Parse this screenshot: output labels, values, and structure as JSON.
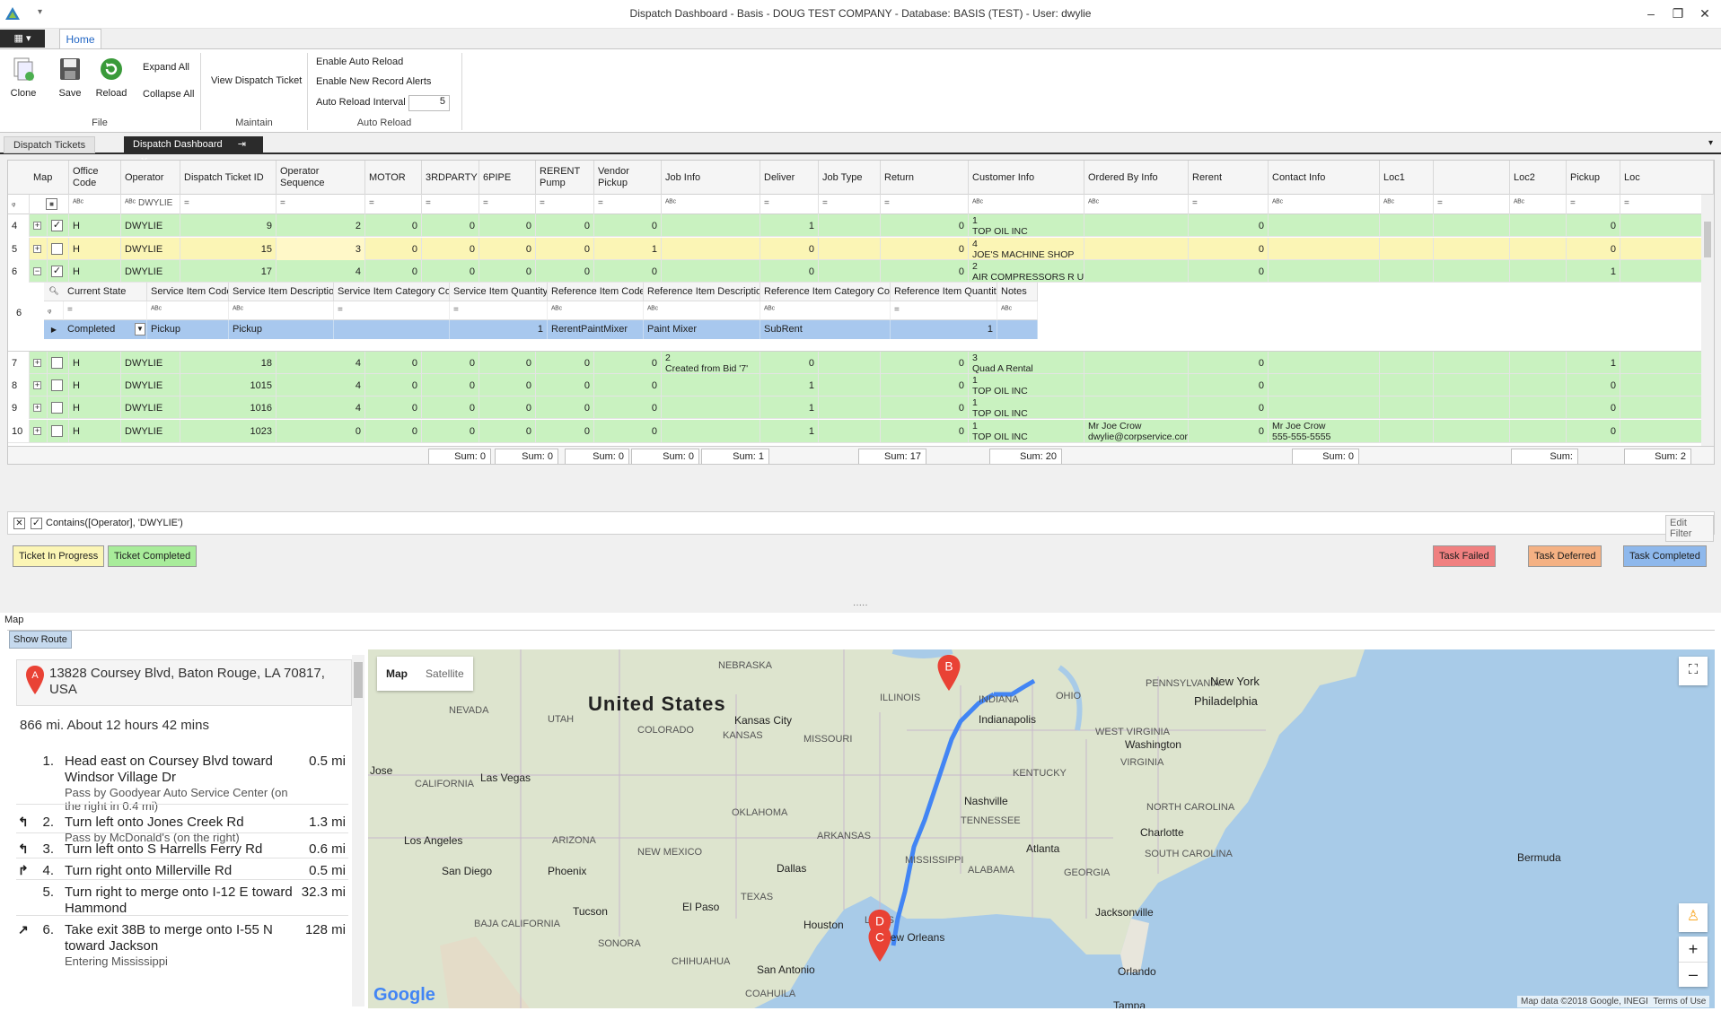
{
  "window": {
    "title": "Dispatch Dashboard - Basis - DOUG TEST COMPANY - Database: BASIS (TEST) - User: dwylie"
  },
  "ribbon": {
    "tab": "Home",
    "clone": "Clone",
    "save": "Save",
    "reload": "Reload",
    "expand_all": "Expand All",
    "collapse_all": "Collapse All",
    "file_group": "File",
    "view_ticket": "View Dispatch Ticket",
    "maintain_group": "Maintain",
    "enable_auto_reload": "Enable Auto Reload",
    "enable_alerts": "Enable New Record Alerts",
    "interval_label": "Auto Reload Interval",
    "interval_value": "5",
    "auto_reload_group": "Auto Reload"
  },
  "doc_tabs": {
    "tab1": "Dispatch Tickets",
    "tab2": "Dispatch Dashboard"
  },
  "grid": {
    "headers": [
      "Map",
      "Office Code",
      "Operator",
      "Dispatch Ticket ID",
      "Operator Sequence",
      "MOTOR",
      "3RDPARTY",
      "6PIPE",
      "RERENT Pump",
      "Vendor Pickup",
      "Job Info",
      "Deliver",
      "Job Type",
      "Return",
      "Customer Info",
      "Ordered By Info",
      "Rerent",
      "Contact Info",
      "Loc1",
      "",
      "Loc2",
      "Pickup",
      "Loc"
    ],
    "filter_operator": "DWYLIE",
    "rows": [
      {
        "rn": "4",
        "office": "H",
        "op": "DWYLIE",
        "id": "9",
        "seq": "2",
        "motor": "0",
        "third": "0",
        "pipe": "0",
        "rerent": "0",
        "vendor": "0",
        "job1": "",
        "job2": "",
        "deliver": "1",
        "jobtype": "",
        "ret": "0",
        "cust1": "1",
        "cust2": "TOP OIL INC",
        "ord1": "",
        "ord2": "",
        "rerent2": "0",
        "contact1": "",
        "contact2": "",
        "pickup": "0"
      },
      {
        "rn": "5",
        "office": "H",
        "op": "DWYLIE",
        "id": "15",
        "seq": "3",
        "motor": "0",
        "third": "0",
        "pipe": "0",
        "rerent": "0",
        "vendor": "1",
        "job1": "",
        "job2": "",
        "deliver": "0",
        "jobtype": "",
        "ret": "0",
        "cust1": "4",
        "cust2": "JOE'S MACHINE SHOP",
        "ord1": "",
        "ord2": "",
        "rerent2": "0",
        "contact1": "",
        "contact2": "",
        "pickup": "0"
      },
      {
        "rn": "6",
        "office": "H",
        "op": "DWYLIE",
        "id": "17",
        "seq": "4",
        "motor": "0",
        "third": "0",
        "pipe": "0",
        "rerent": "0",
        "vendor": "0",
        "job1": "",
        "job2": "",
        "deliver": "0",
        "jobtype": "",
        "ret": "0",
        "cust1": "2",
        "cust2": "AIR COMPRESSORS R US",
        "ord1": "",
        "ord2": "",
        "rerent2": "0",
        "contact1": "",
        "contact2": "",
        "pickup": "1"
      },
      {
        "rn": "7",
        "office": "H",
        "op": "DWYLIE",
        "id": "18",
        "seq": "4",
        "motor": "0",
        "third": "0",
        "pipe": "0",
        "rerent": "0",
        "vendor": "0",
        "job1": "2",
        "job2": "Created from Bid '7'",
        "deliver": "0",
        "jobtype": "",
        "ret": "0",
        "cust1": "3",
        "cust2": "Quad A Rental",
        "ord1": "",
        "ord2": "",
        "rerent2": "0",
        "contact1": "",
        "contact2": "",
        "pickup": "1"
      },
      {
        "rn": "8",
        "office": "H",
        "op": "DWYLIE",
        "id": "1015",
        "seq": "4",
        "motor": "0",
        "third": "0",
        "pipe": "0",
        "rerent": "0",
        "vendor": "0",
        "job1": "",
        "job2": "",
        "deliver": "1",
        "jobtype": "",
        "ret": "0",
        "cust1": "1",
        "cust2": "TOP OIL INC",
        "ord1": "",
        "ord2": "",
        "rerent2": "0",
        "contact1": "",
        "contact2": "",
        "pickup": "0"
      },
      {
        "rn": "9",
        "office": "H",
        "op": "DWYLIE",
        "id": "1016",
        "seq": "4",
        "motor": "0",
        "third": "0",
        "pipe": "0",
        "rerent": "0",
        "vendor": "0",
        "job1": "",
        "job2": "",
        "deliver": "1",
        "jobtype": "",
        "ret": "0",
        "cust1": "1",
        "cust2": "TOP OIL INC",
        "ord1": "",
        "ord2": "",
        "rerent2": "0",
        "contact1": "",
        "contact2": "",
        "pickup": "0"
      },
      {
        "rn": "10",
        "office": "H",
        "op": "DWYLIE",
        "id": "1023",
        "seq": "0",
        "motor": "0",
        "third": "0",
        "pipe": "0",
        "rerent": "0",
        "vendor": "0",
        "job1": "",
        "job2": "",
        "deliver": "1",
        "jobtype": "",
        "ret": "0",
        "cust1": "1",
        "cust2": "TOP OIL INC",
        "ord1": "Mr Joe Crow",
        "ord2": "dwylie@corpservice.com",
        "rerent2": "0",
        "contact1": "Mr Joe Crow",
        "contact2": "555-555-5555",
        "pickup": "0"
      }
    ],
    "detail": {
      "rn": "6",
      "headers": [
        "Current State",
        "Service Item Code",
        "Service Item Description",
        "Service Item Category Code",
        "Service Item Quantity",
        "Reference Item Code",
        "Reference Item Description",
        "Reference Item Category Code",
        "Reference Item Quantity",
        "Notes"
      ],
      "row": {
        "state": "Completed",
        "code": "Pickup",
        "desc": "Pickup",
        "cat": "",
        "qty": "1",
        "ref_code": "RerentPaintMixer",
        "ref_desc": "Paint Mixer",
        "ref_cat": "SubRent",
        "ref_qty": "1",
        "notes": ""
      }
    },
    "sums": {
      "motor": "Sum: 0",
      "third": "Sum: 0",
      "pipe": "Sum: 0",
      "rerent": "Sum: 0",
      "vendor": "Sum: 1",
      "deliver": "Sum: 17",
      "ret": "Sum: 20",
      "rerent2": "Sum: 0",
      "loc": "Sum:",
      "pickup": "Sum: 2"
    }
  },
  "filter": {
    "text": "Contains([Operator], 'DWYLIE')",
    "edit": "Edit Filter"
  },
  "legend": {
    "in_progress": "Ticket In Progress",
    "completed": "Ticket Completed",
    "failed": "Task Failed",
    "deferred": "Task Deferred",
    "task_completed": "Task Completed"
  },
  "colors": {
    "in_progress": "#fbf5b5",
    "completed": "#c9f2c0",
    "failed": "#f08080",
    "deferred": "#f4b183",
    "task_completed": "#8eb8ec"
  },
  "map": {
    "section_label": "Map",
    "show_route": "Show Route",
    "origin": "13828 Coursey Blvd, Baton Rouge, LA 70817, USA",
    "summary": "866 mi. About 12 hours 42 mins",
    "map_btn": "Map",
    "satellite_btn": "Satellite",
    "attribution": "Map data ©2018 Google, INEGI",
    "terms": "Terms of Use",
    "google": "Google",
    "steps": [
      {
        "n": "1.",
        "text": "Head east on Coursey Blvd toward Windsor Village Dr",
        "sub": "Pass by Goodyear Auto Service Center (on the right in 0.4 mi)",
        "dist": "0.5 mi",
        "icon": ""
      },
      {
        "n": "2.",
        "text": "Turn left onto Jones Creek Rd",
        "sub": "Pass by McDonald's (on the right)",
        "dist": "1.3 mi",
        "icon": "turn-left-icon"
      },
      {
        "n": "3.",
        "text": "Turn left onto S Harrells Ferry Rd",
        "sub": "",
        "dist": "0.6 mi",
        "icon": "turn-left-icon"
      },
      {
        "n": "4.",
        "text": "Turn right onto Millerville Rd",
        "sub": "",
        "dist": "0.5 mi",
        "icon": "turn-right-icon"
      },
      {
        "n": "5.",
        "text": "Turn right to merge onto I-12 E toward Hammond",
        "sub": "",
        "dist": "32.3 mi",
        "icon": ""
      },
      {
        "n": "6.",
        "text": "Take exit 38B to merge onto I-55 N toward Jackson",
        "sub": "Entering Mississippi",
        "dist": "128 mi",
        "icon": "ramp-right-icon"
      }
    ],
    "labels": {
      "us": "United States",
      "nebraska": "NEBRASKA",
      "illinois": "ILLINOIS",
      "indiana": "INDIANA",
      "ohio": "OHIO",
      "pennsylvania": "PENNSYLVANIA",
      "newyork": "New York",
      "philadelphia": "Philadelphia",
      "nevada": "NEVADA",
      "utah": "UTAH",
      "colorado": "COLORADO",
      "kansas": "KANSAS",
      "kansascity": "Kansas City",
      "missouri": "MISSOURI",
      "indianapolis": "Indianapolis",
      "wv": "WEST VIRGINIA",
      "washington": "Washington",
      "virginia": "VIRGINIA",
      "kentucky": "KENTUCKY",
      "jose": "Jose",
      "california": "CALIFORNIA",
      "lasvegas": "Las Vegas",
      "nashville": "Nashville",
      "tennessee": "TENNESSEE",
      "oklahoma": "OKLAHOMA",
      "arkansas": "ARKANSAS",
      "nc": "NORTH CAROLINA",
      "losangeles": "Los Angeles",
      "arizona": "ARIZONA",
      "newmexico": "NEW MEXICO",
      "charlotte": "Charlotte",
      "sc": "SOUTH CAROLINA",
      "atlanta": "Atlanta",
      "sandiego": "San Diego",
      "phoenix": "Phoenix",
      "mississippi": "MISSISSIPPI",
      "alabama": "ALABAMA",
      "georgia": "GEORGIA",
      "dallas": "Dallas",
      "tucson": "Tucson",
      "elpaso": "El Paso",
      "texas": "TEXAS",
      "bermuda": "Bermuda",
      "baja": "BAJA CALIFORNIA",
      "louis": "LOUIS",
      "sonora": "SONORA",
      "jacksonville": "Jacksonville",
      "houston": "Houston",
      "neworleans": "New Orleans",
      "chihuahua": "CHIHUAHUA",
      "sanantonio": "San Antonio",
      "orlando": "Orlando",
      "coahuila": "COAHUILA",
      "tampa": "Tampa"
    },
    "markers": {
      "a": "A",
      "b": "B",
      "c": "C",
      "d": "D"
    }
  }
}
